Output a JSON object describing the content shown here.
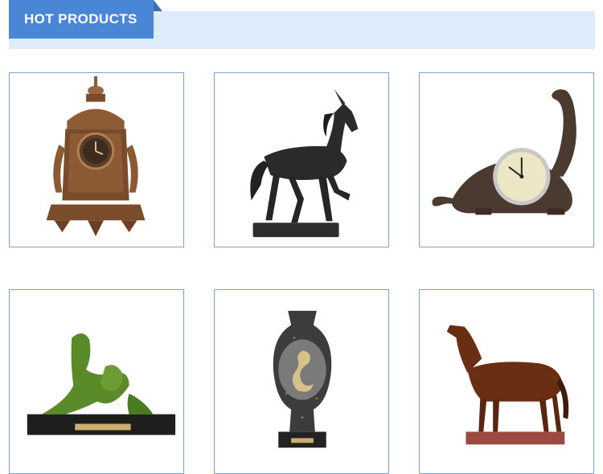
{
  "section": {
    "title": "HOT PRODUCTS"
  },
  "products": [
    {
      "image": "bronze-mantel-clock-image"
    },
    {
      "image": "black-unicorn-statue-image"
    },
    {
      "image": "dinosaur-clock-image"
    },
    {
      "image": "green-abstract-figures-sculpture-image"
    },
    {
      "image": "snake-vase-sculpture-image"
    },
    {
      "image": "brown-horse-statue-image"
    }
  ],
  "colors": {
    "accent": "#4a86d6",
    "banner_bg": "#deebfb",
    "card_border": "#7aa3d6"
  }
}
